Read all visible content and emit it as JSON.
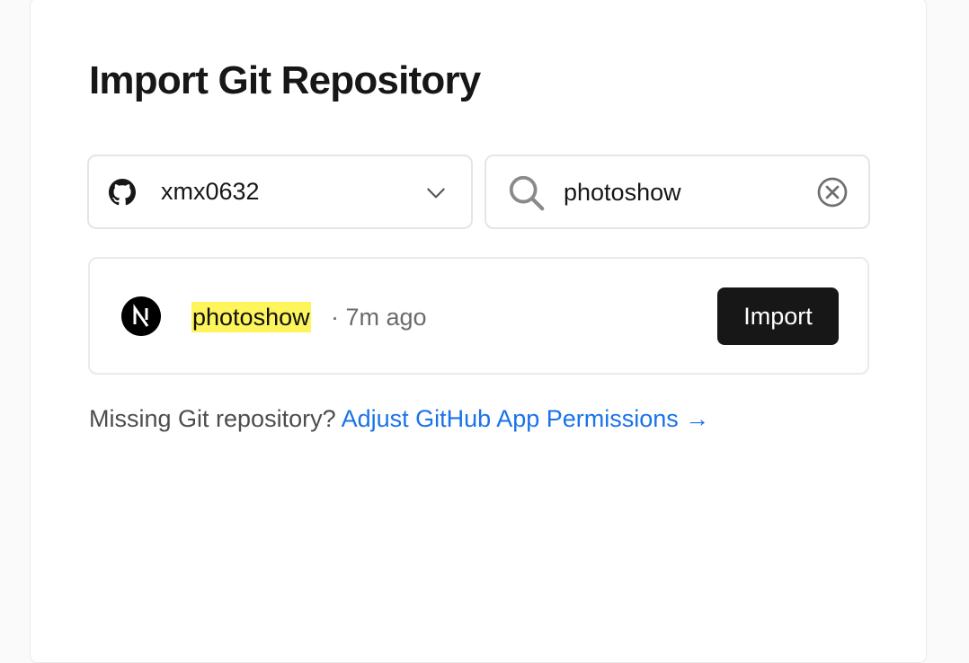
{
  "page": {
    "title": "Import Git Repository"
  },
  "account_select": {
    "icon": "github-icon",
    "value": "xmx0632",
    "chevron_icon": "chevron-down-icon"
  },
  "search": {
    "icon": "search-icon",
    "value": "photoshow",
    "clear_icon": "clear-circle-x-icon"
  },
  "repositories": [
    {
      "avatar_icon": "nextjs-logo-icon",
      "name": "photoshow",
      "meta": "· 7m ago",
      "action_label": "Import"
    }
  ],
  "footer": {
    "text": "Missing Git repository?",
    "link_label": "Adjust GitHub App Permissions →"
  },
  "colors": {
    "highlight": "#fdf55b",
    "link": "#1a73e8",
    "button_bg": "#171717",
    "border": "#e5e5e5"
  }
}
